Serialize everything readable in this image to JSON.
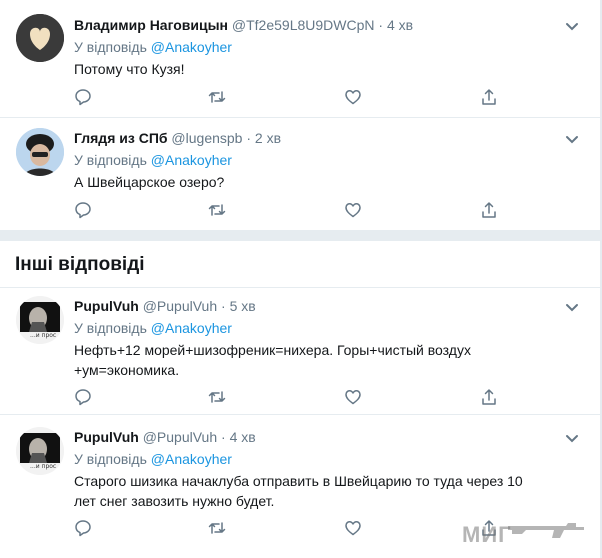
{
  "tweets": [
    {
      "name": "Владимир Наговицын",
      "handle": "@Tf2e59L8U9DWCpN",
      "time": "4 хв",
      "replying_prefix": "У відповідь",
      "replying_to": "@Anakoyher",
      "text": "Потому что Кузя!"
    },
    {
      "name": "Глядя из СПб",
      "handle": "@lugenspb",
      "time": "2 хв",
      "replying_prefix": "У відповідь",
      "replying_to": "@Anakoyher",
      "text": "А Швейцарское озеро?"
    }
  ],
  "section_title": "Інші відповіді",
  "other_tweets": [
    {
      "name": "PupulVuh",
      "handle": "@PupulVuh",
      "time": "5 хв",
      "replying_prefix": "У відповідь",
      "replying_to": "@Anakoyher",
      "text": "Нефть+12 морей+шизофреник=нихера. Горы+чистый воздух +ум=экономика.",
      "avatar_caption": "...и прос"
    },
    {
      "name": "PupulVuh",
      "handle": "@PupulVuh",
      "time": "4 хв",
      "replying_prefix": "У відповідь",
      "replying_to": "@Anakoyher",
      "text": "Старого шизика начаклуба отправить в Швейцарию то туда через 10 лет снег завозить нужно будет.",
      "avatar_caption": "...и прос"
    }
  ],
  "watermark": "МИГ",
  "icons": [
    "reply-icon",
    "retweet-icon",
    "like-icon",
    "share-icon",
    "chevron-down-icon"
  ],
  "colors": {
    "link": "#1b95e0",
    "secondary": "#657786",
    "divider": "#e6ecf0"
  }
}
